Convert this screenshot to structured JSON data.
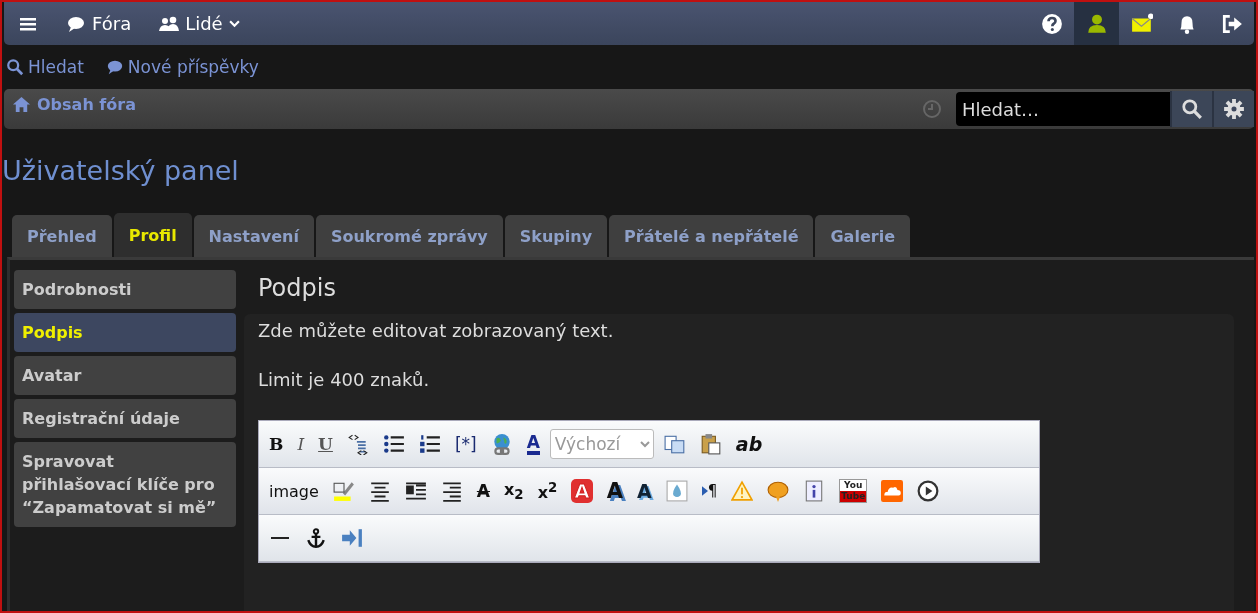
{
  "navbar": {
    "left": [
      {
        "kind": "menu"
      },
      {
        "kind": "chat",
        "label": "Fóra"
      },
      {
        "kind": "people",
        "label": "Lidé",
        "dropdown": true
      }
    ],
    "right": [
      {
        "kind": "help",
        "selected": false
      },
      {
        "kind": "user",
        "selected": true
      },
      {
        "kind": "mail",
        "selected": false
      },
      {
        "kind": "bell",
        "selected": false
      },
      {
        "kind": "logout",
        "selected": false
      }
    ]
  },
  "quick_links": [
    {
      "kind": "search",
      "label": "Hledat"
    },
    {
      "kind": "chat",
      "label": "Nové příspěvky"
    }
  ],
  "breadcrumb": {
    "label": "Obsah fóra",
    "search": {
      "placeholder": "Hledat…"
    }
  },
  "page_title": "Uživatelský panel",
  "tabs": [
    {
      "label": "Přehled",
      "selected": false
    },
    {
      "label": "Profil",
      "selected": true
    },
    {
      "label": "Nastavení",
      "selected": false
    },
    {
      "label": "Soukromé zprávy",
      "selected": false
    },
    {
      "label": "Skupiny",
      "selected": false
    },
    {
      "label": "Přátelé a nepřátelé",
      "selected": false
    },
    {
      "label": "Galerie",
      "selected": false
    }
  ],
  "sidebar": {
    "items": [
      {
        "label": "Podrobnosti",
        "selected": false
      },
      {
        "label": "Podpis",
        "selected": true
      },
      {
        "label": "Avatar",
        "selected": false
      },
      {
        "label": "Registrační údaje",
        "selected": false
      },
      {
        "label": "Spravovat přihlašovací klíče pro “Zapamatovat si mě”",
        "selected": false
      }
    ]
  },
  "panel": {
    "heading": "Podpis",
    "paragraphs": [
      "Zde můžete editovat zobrazovaný text.",
      "Limit je 400 znaků."
    ]
  },
  "editor_toolbar": {
    "rows": [
      {
        "buttons": [
          {
            "kind": "bold",
            "label": "B"
          },
          {
            "kind": "italic",
            "label": "I"
          },
          {
            "kind": "underline",
            "label": "U"
          },
          {
            "kind": "code"
          },
          {
            "kind": "bullets"
          },
          {
            "kind": "numbers"
          },
          {
            "kind": "plain",
            "label": "[*]"
          },
          {
            "kind": "globe"
          },
          {
            "kind": "fontcolor",
            "label": "A"
          },
          {
            "kind": "select",
            "value": "Výchozí"
          },
          {
            "kind": "copy"
          },
          {
            "kind": "paste"
          },
          {
            "kind": "bolditalic",
            "label": "ab"
          }
        ]
      },
      {
        "buttons": [
          {
            "kind": "text",
            "label": "image"
          },
          {
            "kind": "highlight"
          },
          {
            "kind": "center"
          },
          {
            "kind": "justify"
          },
          {
            "kind": "right"
          },
          {
            "kind": "strike",
            "label": "A"
          },
          {
            "kind": "script",
            "label": "x$_{2}$"
          },
          {
            "kind": "script",
            "label": "x$^{2}$"
          },
          {
            "kind": "redletter",
            "label": "A"
          },
          {
            "kind": "shadow",
            "label": "A"
          },
          {
            "kind": "blueshadow",
            "label": "A"
          },
          {
            "kind": "drop"
          },
          {
            "kind": "pilcrow",
            "label": "¶"
          },
          {
            "kind": "warning"
          },
          {
            "kind": "bubble"
          },
          {
            "kind": "info"
          },
          {
            "kind": "tube",
            "label": "You Tube"
          },
          {
            "kind": "cloud"
          },
          {
            "kind": "play"
          }
        ]
      },
      {
        "buttons": [
          {
            "kind": "rule"
          },
          {
            "kind": "anchor"
          },
          {
            "kind": "indent"
          }
        ]
      }
    ]
  }
}
